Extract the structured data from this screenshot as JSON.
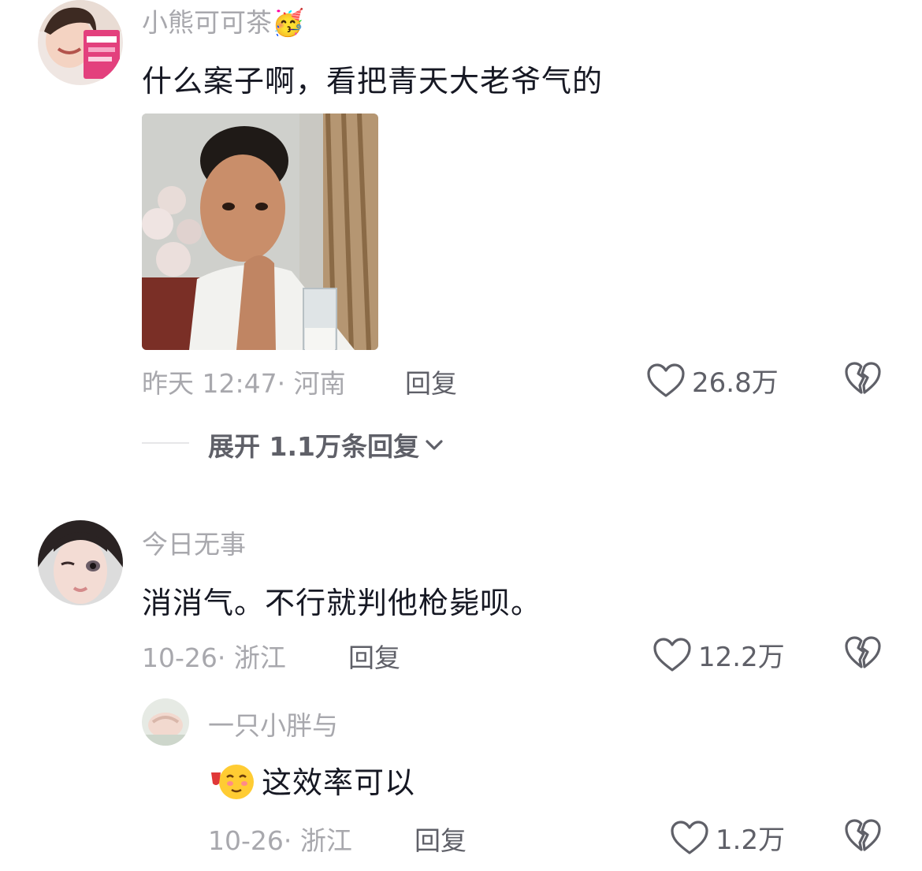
{
  "comments": [
    {
      "username": "小熊可可茶",
      "username_emoji": "🥳",
      "text": "什么案子啊，看把青天大老爷气的",
      "time": "昨天 12:47",
      "location": "河南",
      "reply_label": "回复",
      "likes": "26.8万",
      "expand_label": "展开 1.1万条回复"
    },
    {
      "username": "今日无事",
      "text": "消消气。不行就判他枪毙呗。",
      "time": "10-26",
      "location": "浙江",
      "reply_label": "回复",
      "likes": "12.2万"
    }
  ],
  "sub_reply": {
    "username": "一只小胖与",
    "text": "这效率可以",
    "time": "10-26",
    "location": "浙江",
    "reply_label": "回复",
    "likes": "1.2万"
  },
  "icons": [
    "heart-outline-icon",
    "broken-heart-icon",
    "chevron-down-icon"
  ],
  "colors": {
    "primary_text": "#161823",
    "secondary_text": "#a8a8ad",
    "action_text": "#5f6068",
    "background": "#ffffff"
  }
}
